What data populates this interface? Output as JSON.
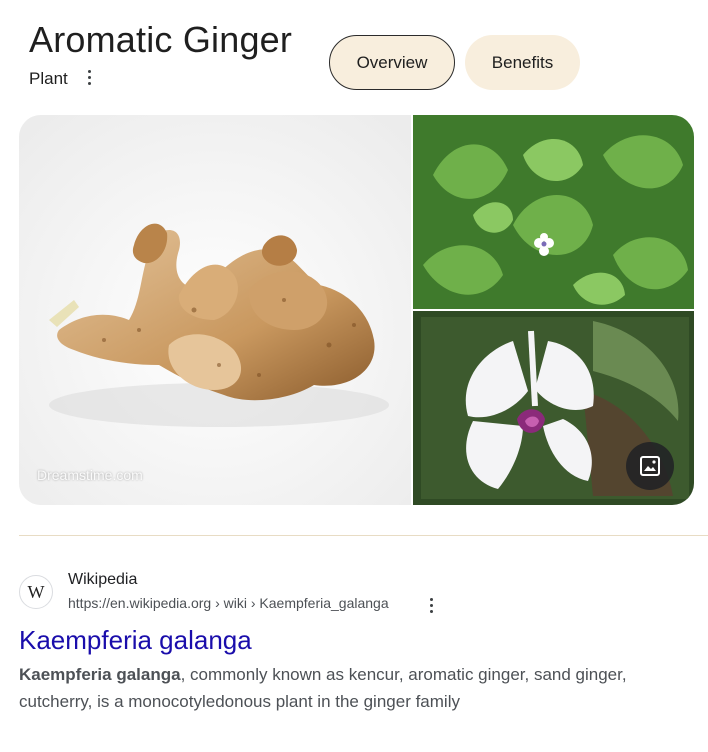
{
  "header": {
    "title": "Aromatic Ginger",
    "subtitle": "Plant",
    "chips": [
      {
        "label": "Overview",
        "selected": true
      },
      {
        "label": "Benefits",
        "selected": false
      }
    ]
  },
  "gallery": {
    "watermark": "Dreamstime.com",
    "images": [
      {
        "subject": "ginger rhizomes"
      },
      {
        "subject": "green leaves"
      },
      {
        "subject": "white flower with purple center"
      }
    ],
    "more_images_icon": "image-icon"
  },
  "result": {
    "favicon_letter": "W",
    "site_name": "Wikipedia",
    "url": "https://en.wikipedia.org › wiki › Kaempferia_galanga",
    "title": "Kaempferia galanga",
    "snippet_bold": "Kaempferia galanga",
    "snippet_rest": ", commonly known as kencur, aromatic ginger, sand ginger, cutcherry, is a monocotyledonous plant in the ginger family"
  },
  "colors": {
    "chip_bg": "#f8eedd",
    "link": "#1a0dab",
    "divider": "#e8dcc4"
  }
}
